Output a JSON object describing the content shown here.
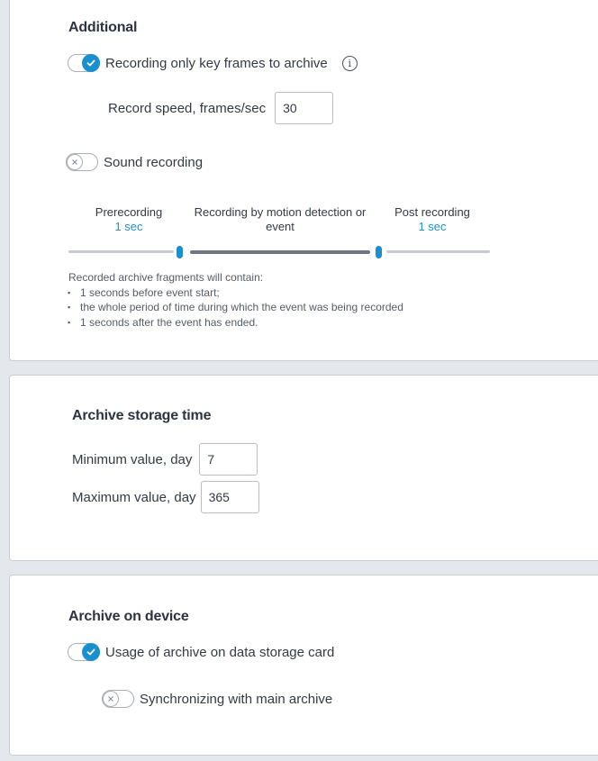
{
  "additional": {
    "title": "Additional",
    "key_frames": {
      "label": "Recording only key frames to archive",
      "checked": true,
      "icon": "info-icon"
    },
    "record_speed": {
      "label": "Record speed, frames/sec",
      "value": "30"
    },
    "sound": {
      "label": "Sound recording",
      "checked": false
    },
    "slider": {
      "pre": {
        "title": "Prerecording",
        "value": "1 sec"
      },
      "middle": {
        "title_line1": "Recording by motion detection or",
        "title_line2": "event"
      },
      "post": {
        "title": "Post recording",
        "value": "1 sec"
      }
    },
    "note": {
      "heading": "Recorded archive fragments will contain:",
      "items": [
        "1 seconds before event start;",
        "the whole period of time during which the event was being recorded",
        "1 seconds after the event has ended."
      ]
    }
  },
  "storage": {
    "title": "Archive storage time",
    "min": {
      "label": "Minimum value, day",
      "value": "7"
    },
    "max": {
      "label": "Maximum value, day",
      "value": "365"
    }
  },
  "device": {
    "title": "Archive on device",
    "usage": {
      "label": "Usage of archive on data storage card",
      "checked": true
    },
    "sync": {
      "label": "Synchronizing with main archive",
      "checked": false
    }
  },
  "colors": {
    "accent": "#1a8fd0",
    "background": "#e4e7ec",
    "card": "#ffffff"
  }
}
